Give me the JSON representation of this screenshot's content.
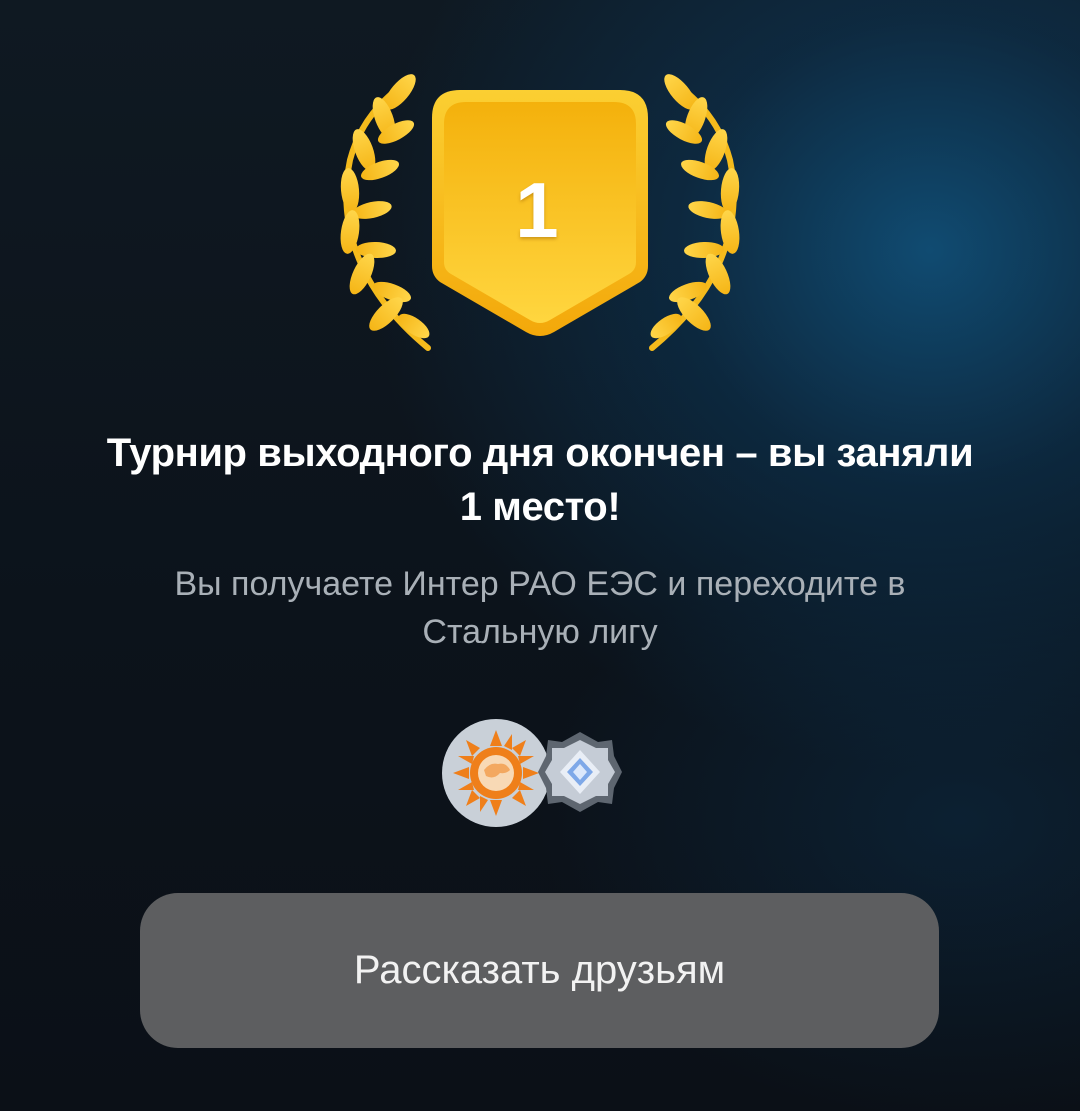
{
  "result": {
    "place": "1",
    "title": "Турнир выходного дня окончен – вы заняли 1 место!",
    "subtitle": "Вы получаете Интер РАО ЕЭС и переходите в Стальную лигу"
  },
  "rewards": {
    "items": [
      {
        "icon": "inter-rao-logo-icon"
      },
      {
        "icon": "steel-league-badge-icon"
      }
    ]
  },
  "actions": {
    "share_label": "Рассказать друзьям"
  },
  "colors": {
    "gold": "#f6b80c",
    "gold_light": "#ffd84a",
    "button_bg": "#5d5e60",
    "subtitle_text": "#a9b0b7",
    "logo_orange": "#ef7f1a"
  }
}
